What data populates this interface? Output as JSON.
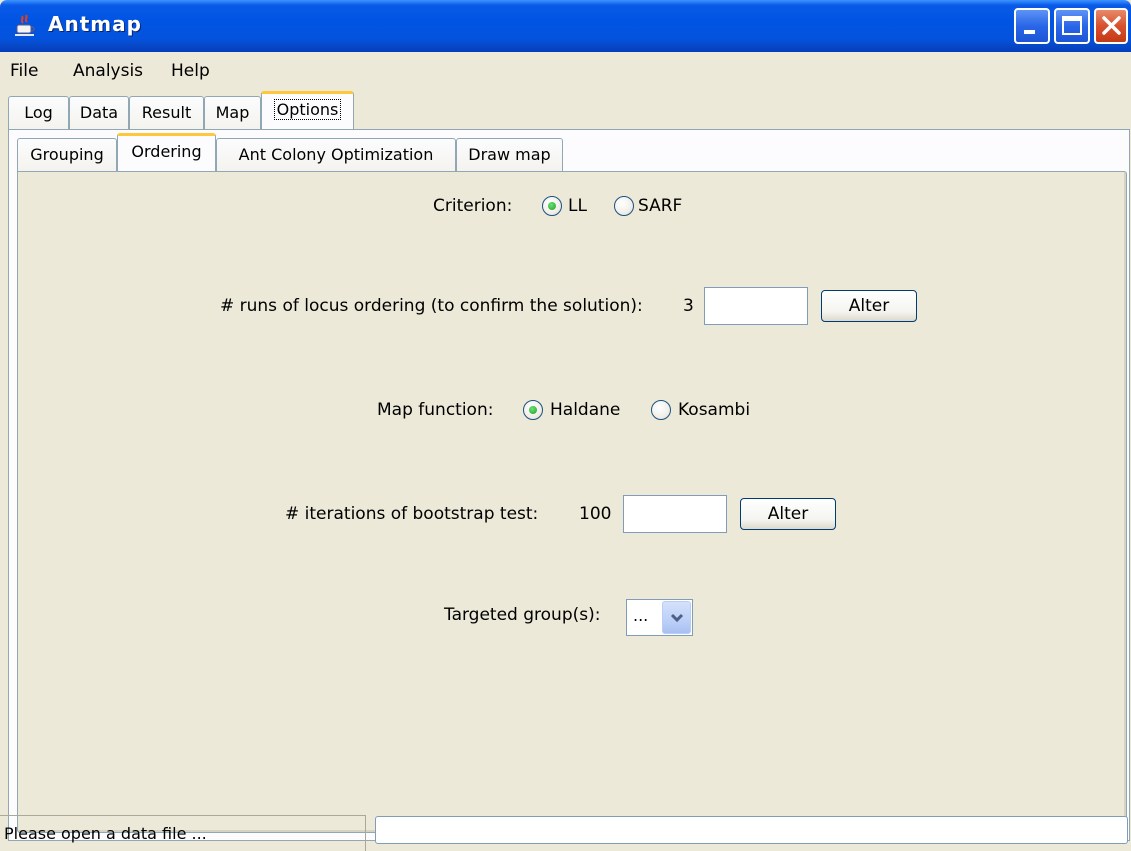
{
  "window": {
    "title": "Antmap",
    "icon": "java-cup-icon"
  },
  "menu": [
    "File",
    "Analysis",
    "Help"
  ],
  "outer_tabs": [
    "Log",
    "Data",
    "Result",
    "Map",
    "Options"
  ],
  "outer_active": "Options",
  "inner_tabs": [
    "Grouping",
    "Ordering",
    "Ant Colony Optimization",
    "Draw map"
  ],
  "inner_active": "Ordering",
  "ordering": {
    "criterion_label": "Criterion:",
    "criterion_options": [
      "LL",
      "SARF"
    ],
    "criterion_selected": "LL",
    "runs_label": "# runs of locus ordering (to confirm the solution):",
    "runs_value": "3",
    "runs_input": "",
    "alter_label": "Alter",
    "map_function_label": "Map function:",
    "map_function_options": [
      "Haldane",
      "Kosambi"
    ],
    "map_function_selected": "Haldane",
    "bootstrap_label": "# iterations of bootstrap test:",
    "bootstrap_value": "100",
    "bootstrap_input": "",
    "targeted_label": "Targeted group(s):",
    "targeted_value": "..."
  },
  "status": {
    "message": "Please open a data file ...",
    "progress_text": ""
  },
  "colors": {
    "titlebar": "#0054e3",
    "window_bg": "#ece9d8",
    "tab_highlight": "#ffc83c",
    "radio_dot": "#21a121"
  }
}
